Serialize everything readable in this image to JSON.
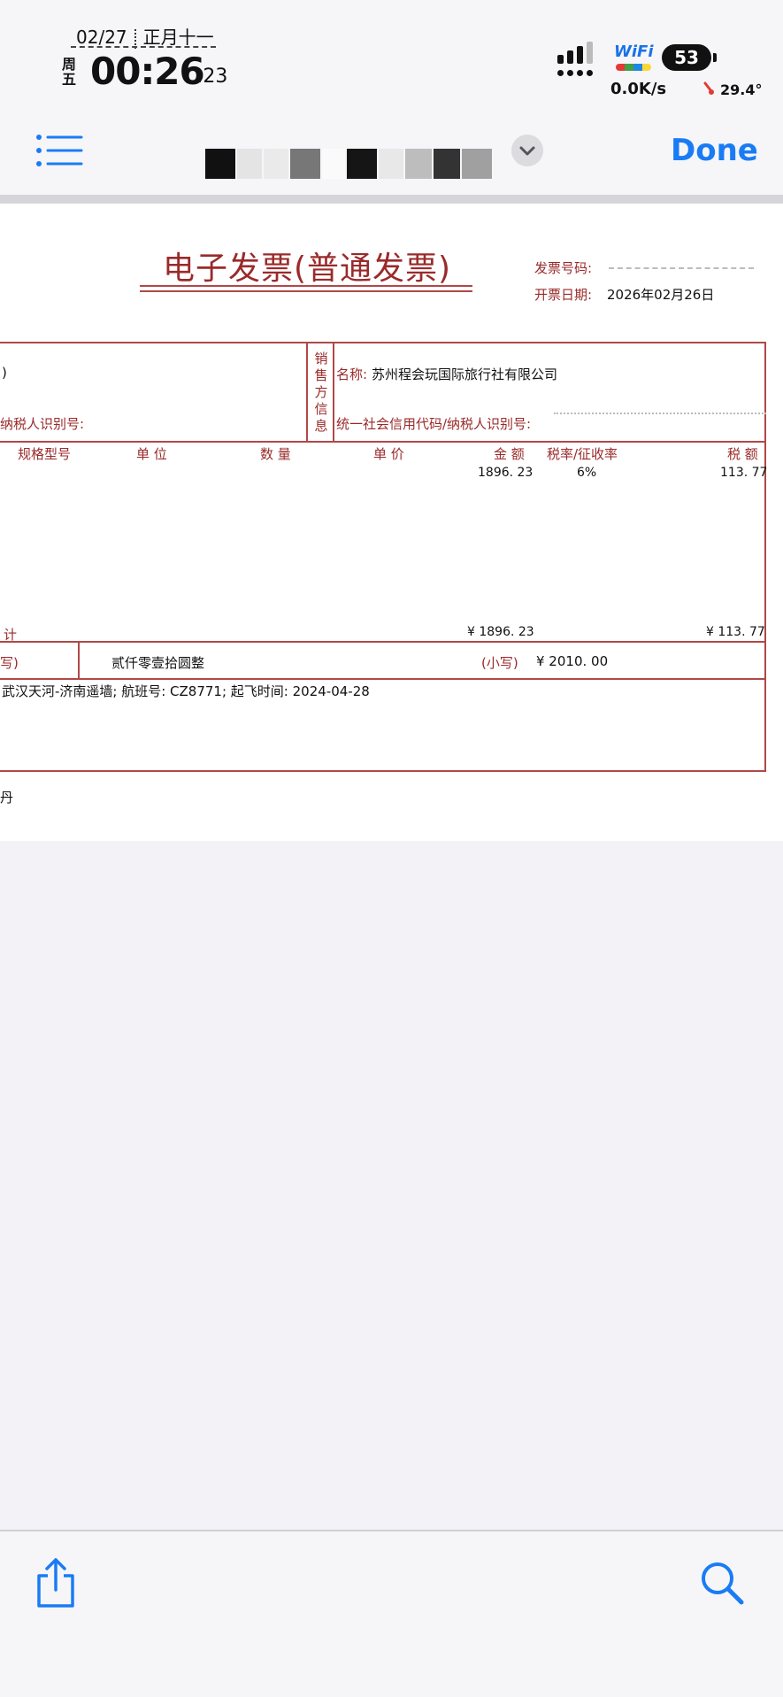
{
  "status_bar": {
    "date": "02/27",
    "lunar_date": "正月十一",
    "weekday": "周五",
    "time": "00:26",
    "seconds": ":23",
    "wifi_label": "WiFi",
    "battery": "53",
    "net_speed": "0.0K/s",
    "temperature": "29.4°"
  },
  "nav": {
    "done_label": "Done",
    "list_icon": "list-icon",
    "chevron_icon": "chevron-down-icon"
  },
  "invoice": {
    "title": "电子发票(普通发票)",
    "invoice_no_label": "发票号码:",
    "issue_date_label": "开票日期:",
    "issue_date": "2026年02月26日",
    "buyer_partial_name": ")",
    "buyer_tax_label": "纳税人识别号:",
    "seller_side_label": "销售方信息",
    "seller_name_label": "名称:",
    "seller_name": "苏州程会玩国际旅行社有限公司",
    "seller_tax_label": "统一社会信用代码/纳税人识别号:",
    "headers": {
      "spec": "规格型号",
      "unit": "单 位",
      "qty": "数 量",
      "price": "单 价",
      "amount": "金 额",
      "rate": "税率/征收率",
      "tax": "税 额"
    },
    "line": {
      "amount": "1896. 23",
      "rate": "6%",
      "tax": "113. 77"
    },
    "total_label": "计",
    "total_amount": "¥ 1896. 23",
    "total_tax": "¥ 113. 77",
    "big_label_partial": "写)",
    "amount_chinese": "贰仟零壹拾圆整",
    "small_label": "(小写)",
    "amount_small": "¥ 2010. 00",
    "remark": "武汉天河-济南遥墙; 航班号: CZ8771; 起飞时间: 2024-04-28",
    "footer_partial": "丹"
  },
  "toolbar": {
    "share_icon": "share-icon",
    "search_icon": "search-icon"
  },
  "colors": {
    "accent": "#1a7cf5",
    "invoice_red": "#9a2a2a",
    "background": "#f2f2f7"
  }
}
